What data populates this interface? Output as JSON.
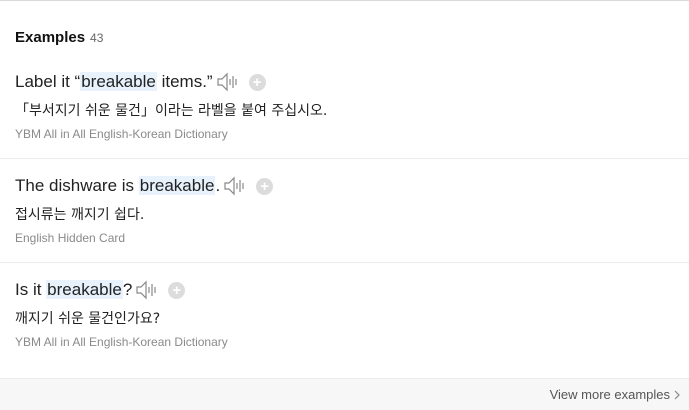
{
  "header": {
    "title": "Examples",
    "count": "43"
  },
  "examples": [
    {
      "en_pre": "Label it “",
      "en_hl": "breakable",
      "en_post": " items.”",
      "ko": "「부서지기 쉬운 물건」이라는 라벨을 붙여 주십시오.",
      "source": "YBM All in All English-Korean Dictionary"
    },
    {
      "en_pre": "The dishware is ",
      "en_hl": "breakable",
      "en_post": ".",
      "ko": "접시류는 깨지기 쉽다.",
      "source": "English Hidden Card"
    },
    {
      "en_pre": "Is it ",
      "en_hl": "breakable",
      "en_post": "?",
      "ko": "깨지기 쉬운 물건인가요?",
      "source": "YBM All in All English-Korean Dictionary"
    }
  ],
  "footer": {
    "more_label": "View more examples"
  },
  "icons": {
    "speaker": "speaker-icon",
    "add": "add-icon",
    "chevron": "chevron-right-icon"
  },
  "colors": {
    "highlight": "#e8f2fd",
    "source_text": "#8a8a8a"
  }
}
